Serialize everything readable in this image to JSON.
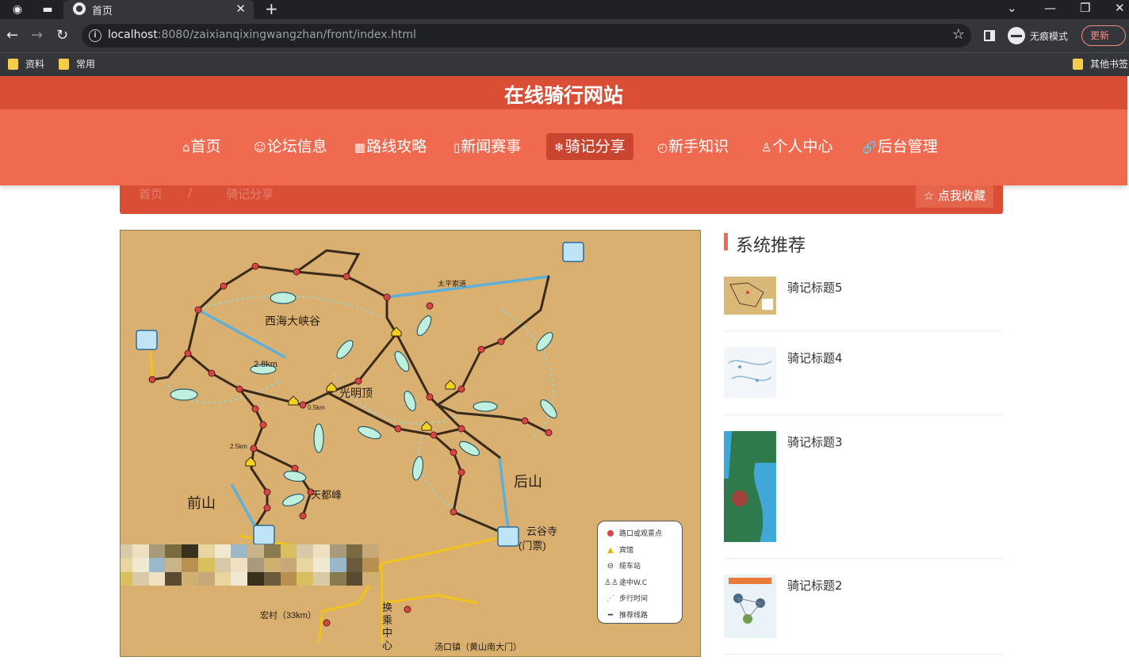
{
  "browser": {
    "tab_title": "首页",
    "url_host": "localhost",
    "url_rest": ":8080/zaixianqixingwangzhan/front/index.html",
    "incognito_label": "无痕模式",
    "update_label": "更新",
    "bookmarks": [
      "资料",
      "常用"
    ],
    "other_bookmarks": "其他书签"
  },
  "site": {
    "title": "在线骑行网站",
    "nav": [
      {
        "icon": "⌂",
        "label": "首页"
      },
      {
        "icon": "☺",
        "label": "论坛信息"
      },
      {
        "icon": "▦",
        "label": "路线攻略"
      },
      {
        "icon": "▯",
        "label": "新闻赛事"
      },
      {
        "icon": "❄",
        "label": "骑记分享",
        "active": true
      },
      {
        "icon": "◴",
        "label": "新手知识"
      },
      {
        "icon": "♙",
        "label": "个人中心"
      },
      {
        "icon": "🔗",
        "label": "后台管理"
      }
    ],
    "breadcrumb": [
      "首页",
      "/",
      "骑记分享"
    ],
    "favorite_button": "☆ 点我收藏"
  },
  "map": {
    "labels": {
      "west_canyon": "西海大峡谷",
      "guangming": "光明顶",
      "houshan": "后山",
      "qianshan": "前山",
      "tiandu": "天都峰",
      "yungu": "云谷寺",
      "menpiao": "(门票)",
      "hongcun": "宏村（33km）",
      "tangkou": "汤口镇（黄山南大门）",
      "transfer": "换乘中心",
      "taiping": "太平索道",
      "dist_28": "2.8km",
      "dist_05": "0.5km",
      "dist_25": "2.5km"
    },
    "legend": [
      {
        "icon": "dot",
        "label": "路口或观景点"
      },
      {
        "icon": "hotel",
        "label": "宾馆"
      },
      {
        "icon": "cable",
        "label": "缆车站"
      },
      {
        "icon": "wc",
        "label": "途中W.C"
      },
      {
        "icon": "walk",
        "label": "步行时间"
      },
      {
        "icon": "route",
        "label": "推荐线路"
      }
    ]
  },
  "sidebar": {
    "heading": "系统推荐",
    "items": [
      {
        "title": "骑记标题5"
      },
      {
        "title": "骑记标题4"
      },
      {
        "title": "骑记标题3"
      },
      {
        "title": "骑记标题2"
      }
    ]
  },
  "colors": {
    "header": "#ef6a4f",
    "header_dark": "#d94e35",
    "map_bg": "#d9b070"
  }
}
